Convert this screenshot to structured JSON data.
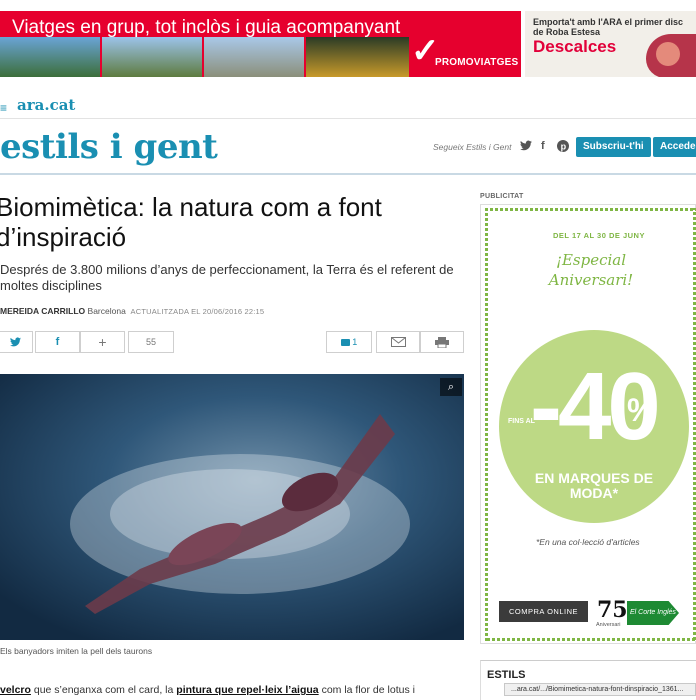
{
  "top_ad": {
    "headline": "Viatges en grup, tot inclòs i guia acompanyant",
    "brand": "PROMOVIATGES"
  },
  "side_ad": {
    "line1": "Emporta't amb l'ARA el primer disc de Roba Estesa",
    "brand": "Descalces"
  },
  "site": {
    "logo": "ara.cat",
    "section": "estils i gent",
    "follow_label": "Segueix Estils i Gent",
    "subscribe": "Subscriu-t'hi",
    "login": "Accedeix"
  },
  "article": {
    "headline": "Biomimètica: la natura com a font d’inspiració",
    "subhead": "Després de 3.800 milions d’anys de perfeccionament, la Terra és el referent de moltes disciplines",
    "author": "MEREIDA CARRILLO",
    "city": "Barcelona",
    "updated": "ACTUALITZADA EL 20/06/2016 22:15",
    "share_count": "55",
    "comments_count": "1",
    "caption": "Els banyadors imiten la pell dels taurons",
    "body_link1": "velcro",
    "body_text1": " que s’enganxa com el card, la ",
    "body_link2": "pintura que repel·leix l’aigua",
    "body_text2": " com la flor de lotus i"
  },
  "right_ad": {
    "label": "PUBLICITAT",
    "dates": "DEL 17 AL 30 DE JUNY",
    "especial": "¡Especial Aniversari!",
    "fins": "FINS AL",
    "discount": "-40",
    "pct": "%",
    "sub": "EN MARQUES DE MODA*",
    "note": "*En una col·lecció d'articles",
    "button": "COMPRA ONLINE",
    "aniv_num": "75",
    "aniv": "Aniversari",
    "store": "El Corte Inglés"
  },
  "sidebar": {
    "estils_title": "ESTILS"
  },
  "statusbar": {
    "url": "...ara.cat/.../Biomimetica-natura-font-dinspiracio_1361..."
  },
  "colors": {
    "brand": "#1a8fb2",
    "ad_red": "#e6002e",
    "ad_green": "#7fb644"
  }
}
